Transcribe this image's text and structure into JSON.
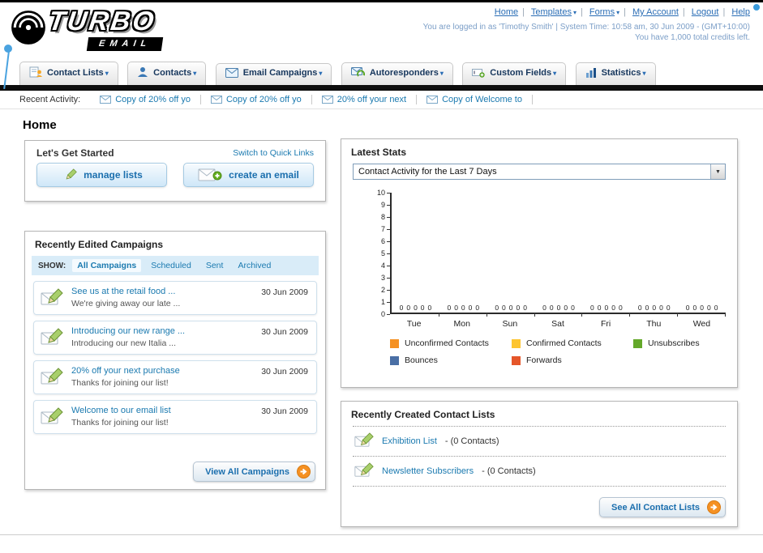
{
  "ui": {
    "sep": "|"
  },
  "icons": {
    "chevron_down": "▾",
    "select_arrow": "▼"
  },
  "colors": {
    "accent_link": "#1b7ab0",
    "nav_text": "#16365c",
    "header_bar": "#0d0d0d",
    "button_text": "#1b6fae",
    "arrow_circle": "#f59123"
  },
  "header": {
    "logo_title": "TURBO",
    "logo_subtitle": "EMAIL",
    "top_links": [
      {
        "label": "Home"
      },
      {
        "label": "Templates"
      },
      {
        "label": "Forms"
      },
      {
        "label": "My Account"
      },
      {
        "label": "Logout"
      },
      {
        "label": "Help"
      }
    ],
    "login_info": "You are logged in as 'Timothy Smith' | System Time: 10:58 am, 30 Jun 2009 - (GMT+10:00)",
    "credits_info": "You have 1,000 total credits left."
  },
  "nav": {
    "tabs": [
      {
        "label": "Contact Lists",
        "icon": "contact-lists-icon"
      },
      {
        "label": "Contacts",
        "icon": "contacts-icon"
      },
      {
        "label": "Email Campaigns",
        "icon": "email-campaigns-icon"
      },
      {
        "label": "Autoresponders",
        "icon": "autoresponders-icon"
      },
      {
        "label": "Custom Fields",
        "icon": "custom-fields-icon"
      },
      {
        "label": "Statistics",
        "icon": "statistics-icon"
      }
    ]
  },
  "recent_activity": {
    "label": "Recent Activity:",
    "items": [
      "Copy of 20% off yo",
      "Copy of 20% off yo",
      "20% off your next",
      "Copy of Welcome to"
    ]
  },
  "page_title": "Home",
  "get_started": {
    "title": "Let's Get Started",
    "switch_link": "Switch to Quick Links",
    "buttons": [
      {
        "label": "manage lists",
        "icon": "pencil-icon"
      },
      {
        "label": "create an email",
        "icon": "envelope-plus-icon"
      }
    ]
  },
  "campaigns": {
    "title": "Recently Edited Campaigns",
    "show_label": "SHOW:",
    "tabs": [
      {
        "label": "All Campaigns",
        "selected": true
      },
      {
        "label": "Scheduled",
        "selected": false
      },
      {
        "label": "Sent",
        "selected": false
      },
      {
        "label": "Archived",
        "selected": false
      }
    ],
    "items": [
      {
        "title": "See us at the retail food ...",
        "subtitle": "We're giving away our late ...",
        "date": "30 Jun 2009"
      },
      {
        "title": "Introducing our new range ...",
        "subtitle": "Introducing our new Italia ...",
        "date": "30 Jun 2009"
      },
      {
        "title": "20% off your next purchase",
        "subtitle": "Thanks for joining our list!",
        "date": "30 Jun 2009"
      },
      {
        "title": "Welcome to our email list",
        "subtitle": "Thanks for joining our list!",
        "date": "30 Jun 2009"
      }
    ],
    "view_all_label": "View All Campaigns"
  },
  "stats": {
    "title": "Latest Stats",
    "selector_value": "Contact Activity for the Last 7 Days",
    "chart_data": {
      "type": "bar",
      "title": "Contact Activity for the Last 7 Days",
      "categories": [
        "Tue",
        "Mon",
        "Sun",
        "Sat",
        "Fri",
        "Thu",
        "Wed"
      ],
      "series": [
        {
          "name": "Unconfirmed Contacts",
          "color": "#f59123",
          "values": [
            0,
            0,
            0,
            0,
            0,
            0,
            0
          ]
        },
        {
          "name": "Confirmed Contacts",
          "color": "#fdc531",
          "values": [
            0,
            0,
            0,
            0,
            0,
            0,
            0
          ]
        },
        {
          "name": "Unsubscribes",
          "color": "#63a829",
          "values": [
            0,
            0,
            0,
            0,
            0,
            0,
            0
          ]
        },
        {
          "name": "Bounces",
          "color": "#4a6fa5",
          "values": [
            0,
            0,
            0,
            0,
            0,
            0,
            0
          ]
        },
        {
          "name": "Forwards",
          "color": "#e5562a",
          "values": [
            0,
            0,
            0,
            0,
            0,
            0,
            0
          ]
        }
      ],
      "ylim": [
        0,
        10
      ],
      "ytick_step": 1,
      "grid": false,
      "legend_position": "bottom"
    }
  },
  "contact_lists": {
    "title": "Recently Created Contact Lists",
    "items": [
      {
        "name": "Exhibition List",
        "detail": "- (0 Contacts)"
      },
      {
        "name": "Newsletter Subscribers",
        "detail": "- (0 Contacts)"
      }
    ],
    "see_all_label": "See All Contact Lists"
  }
}
